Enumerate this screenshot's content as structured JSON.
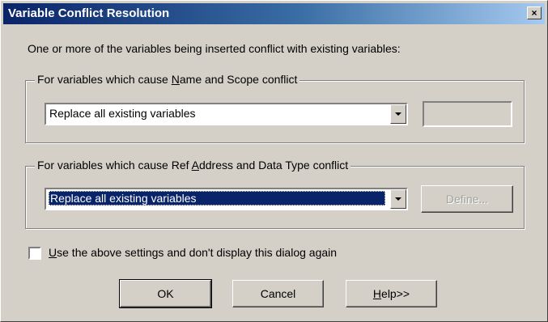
{
  "dialog": {
    "title": "Variable Conflict Resolution",
    "close_glyph": "×",
    "intro": "One or more of the variables being inserted conflict with existing variables:"
  },
  "group_name_scope": {
    "legend_pre": "For variables which cause ",
    "legend_mnemonic": "N",
    "legend_post": "ame and Scope conflict",
    "selected": "Replace all existing variables"
  },
  "group_ref_address": {
    "legend_pre": "For variables which cause Ref ",
    "legend_mnemonic": "A",
    "legend_post": "ddress and Data Type conflict",
    "selected": "Replace all existing variables",
    "define_label": "Define..."
  },
  "dont_show": {
    "mnemonic": "U",
    "label_rest": "se the above settings and don't display this dialog again",
    "checked": false
  },
  "buttons": {
    "ok": "OK",
    "cancel": "Cancel",
    "help_mnemonic": "H",
    "help_rest": "elp>>"
  }
}
